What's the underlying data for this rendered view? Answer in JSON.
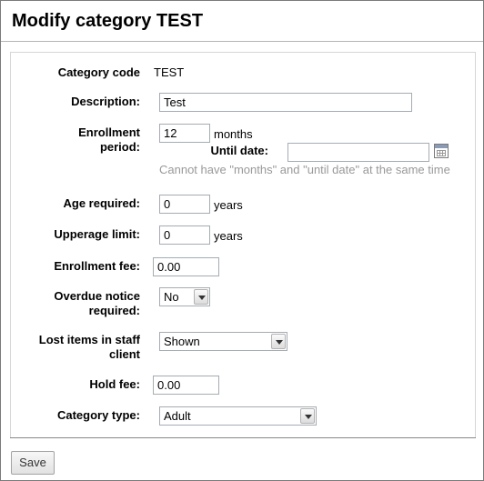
{
  "page": {
    "title": "Modify category TEST"
  },
  "form": {
    "category_code": {
      "label": "Category code",
      "value": "TEST"
    },
    "description": {
      "label": "Description:",
      "value": "Test"
    },
    "enrollment_period": {
      "label_line1": "Enrollment",
      "label_line2": "period:",
      "months_value": "12",
      "months_unit": "months",
      "until_date_label": "Until date:",
      "until_date_value": "",
      "hint": "Cannot have \"months\" and \"until date\" at the same time"
    },
    "age_required": {
      "label": "Age required:",
      "value": "0",
      "unit": "years"
    },
    "upperage_limit": {
      "label": "Upperage limit:",
      "value": "0",
      "unit": "years"
    },
    "enrollment_fee": {
      "label": "Enrollment fee:",
      "value": "0.00"
    },
    "overdue_notice": {
      "label_line1": "Overdue notice",
      "label_line2": "required:",
      "selected": "No"
    },
    "lost_items": {
      "label_line1": "Lost items in staff",
      "label_line2": "client",
      "selected": "Shown"
    },
    "hold_fee": {
      "label": "Hold fee:",
      "value": "0.00"
    },
    "category_type": {
      "label": "Category type:",
      "selected": "Adult"
    }
  },
  "actions": {
    "save_label": "Save"
  },
  "icons": {
    "calendar": "calendar-icon",
    "dropdown": "chevron-down-icon"
  }
}
